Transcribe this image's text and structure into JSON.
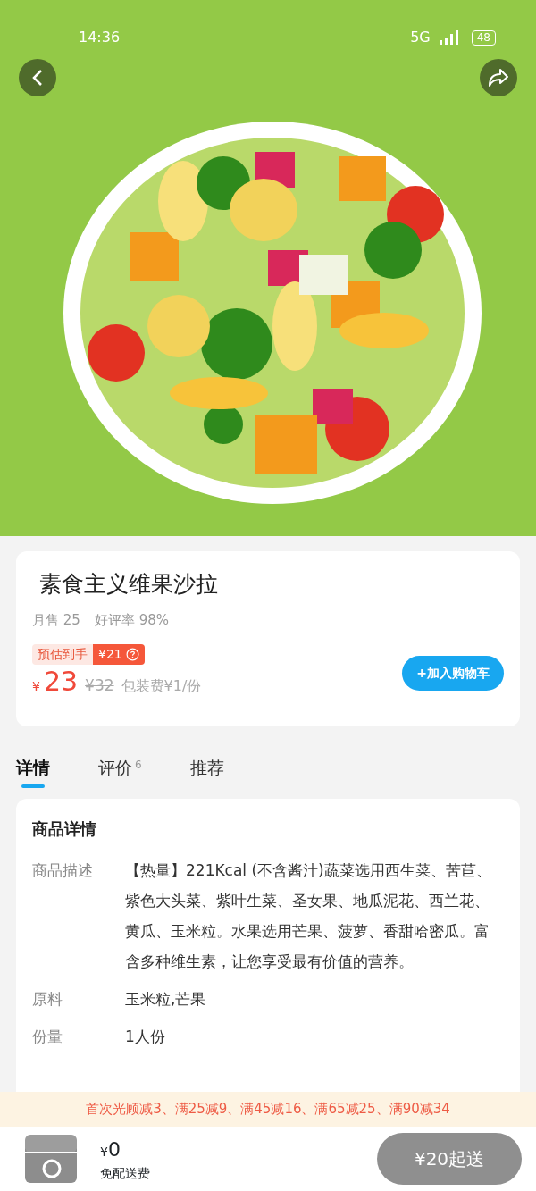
{
  "status_bar": {
    "time": "14:36",
    "network": "5G",
    "battery": "48"
  },
  "product": {
    "name": "素食主义维果沙拉",
    "monthly_sales": "月售 25",
    "rating": "好评率 98%",
    "estimate_label": "预估到手",
    "estimate_price": "¥21",
    "currency": "¥",
    "price": "23",
    "original_price": "¥32",
    "packing_fee": "包装费¥1/份",
    "add_button": "+加入购物车"
  },
  "tabs": [
    {
      "label": "详情",
      "selected": true
    },
    {
      "label": "评价",
      "count": "6",
      "selected": false
    },
    {
      "label": "推荐",
      "selected": false
    }
  ],
  "details": {
    "title": "商品详情",
    "rows": [
      {
        "label": "商品描述",
        "value": "【热量】221Kcal (不含酱汁)蔬菜选用西生菜、苦苣、紫色大头菜、紫叶生菜、圣女果、地瓜泥花、西兰花、黄瓜、玉米粒。水果选用芒果、菠萝、香甜哈密瓜。富含多种维生素，让您享受最有价值的营养。"
      },
      {
        "label": "原料",
        "value": "玉米粒,芒果"
      },
      {
        "label": "份量",
        "value": "1人份"
      }
    ]
  },
  "promo_banner": "首次光顾减3、满25减9、满45减16、满65减25、满90减34",
  "cart": {
    "currency": "¥",
    "amount": "0",
    "delivery": "免配送费",
    "checkout_button": "¥20起送",
    "disabled": true
  }
}
